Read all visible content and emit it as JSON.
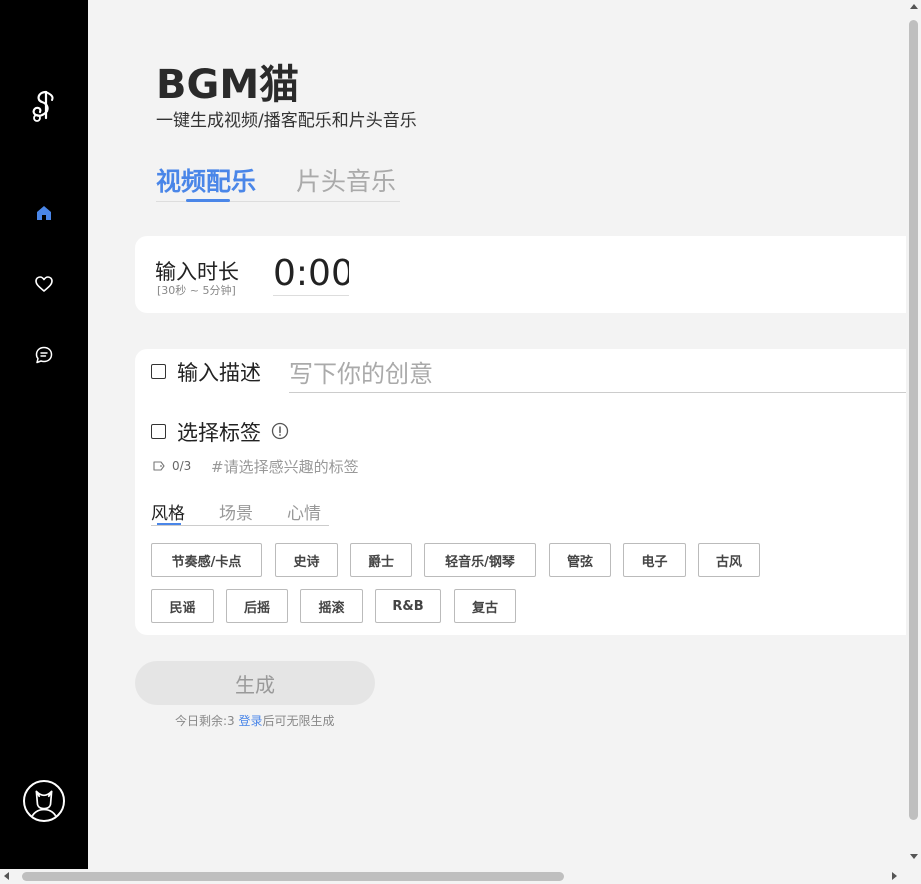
{
  "app": {
    "title": "BGM猫",
    "subtitle": "一键生成视频/播客配乐和片头音乐"
  },
  "sidebar": {
    "logo": "music-note-logo",
    "items": [
      {
        "icon": "home-icon",
        "active": true
      },
      {
        "icon": "heart-icon",
        "active": false
      },
      {
        "icon": "chat-icon",
        "active": false
      }
    ],
    "avatar": "cat-avatar-icon"
  },
  "tabs": [
    {
      "label": "视频配乐",
      "active": true
    },
    {
      "label": "片头音乐",
      "active": false
    }
  ],
  "duration": {
    "label": "输入时长",
    "hint": "[30秒 ~ 5分钟]",
    "value": "0:00"
  },
  "description": {
    "label": "输入描述",
    "checked": false,
    "placeholder": "写下你的创意"
  },
  "tags": {
    "label": "选择标签",
    "checked": false,
    "count": "0/3",
    "hint": "#请选择感兴趣的标签",
    "subtabs": [
      {
        "label": "风格",
        "active": true
      },
      {
        "label": "场景",
        "active": false
      },
      {
        "label": "心情",
        "active": false
      }
    ],
    "items": [
      "节奏感/卡点",
      "史诗",
      "爵士",
      "轻音乐/钢琴",
      "管弦",
      "电子",
      "古风",
      "民谣",
      "后摇",
      "摇滚",
      "R&B",
      "复古"
    ]
  },
  "generate": {
    "label": "生成",
    "quota_prefix": "今日剩余:3 ",
    "quota_link": "登录",
    "quota_suffix": "后可无限生成"
  },
  "colors": {
    "accent": "#4a86e8",
    "sidebar_bg": "#000000",
    "page_bg": "#f3f3f3"
  }
}
